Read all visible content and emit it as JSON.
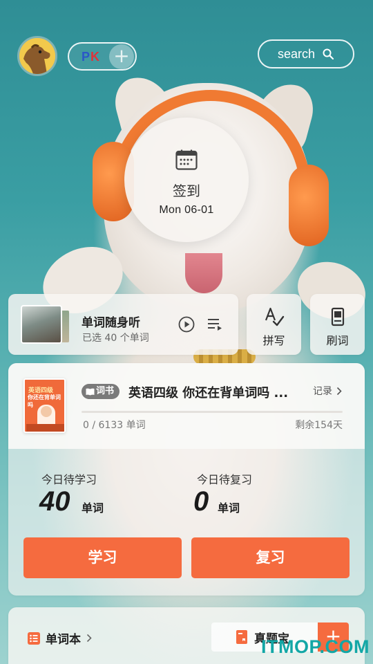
{
  "header": {
    "pk_p": "P",
    "pk_k": "K",
    "pk_plus": "+",
    "search_label": "search"
  },
  "checkin": {
    "title": "签到",
    "date": "Mon  06-01"
  },
  "listen": {
    "title": "单词随身听",
    "subtitle": "已选 40 个单词"
  },
  "shortcuts": {
    "spell": "拼写",
    "flash": "刷词"
  },
  "book": {
    "tag": "词书",
    "title": "英语四级 你还在背单词吗 ...",
    "records_label": "记录",
    "progress_text": "0 / 6133 单词",
    "progress_fraction": 0,
    "remaining": "剩余154天",
    "cover_line1": "英语四级",
    "cover_line2": "你还在背单词吗"
  },
  "stats": {
    "study_label": "今日待学习",
    "study_count": "40",
    "review_label": "今日待复习",
    "review_count": "0",
    "unit": "单词"
  },
  "buttons": {
    "study": "学习",
    "review": "复习"
  },
  "bottom": {
    "vocab_label": "单词本",
    "exam_label": "真题宝",
    "add": "+"
  },
  "watermark": "ITMOP.COM",
  "colors": {
    "accent": "#f56b3f",
    "background_teal": "#3a9ea3"
  }
}
